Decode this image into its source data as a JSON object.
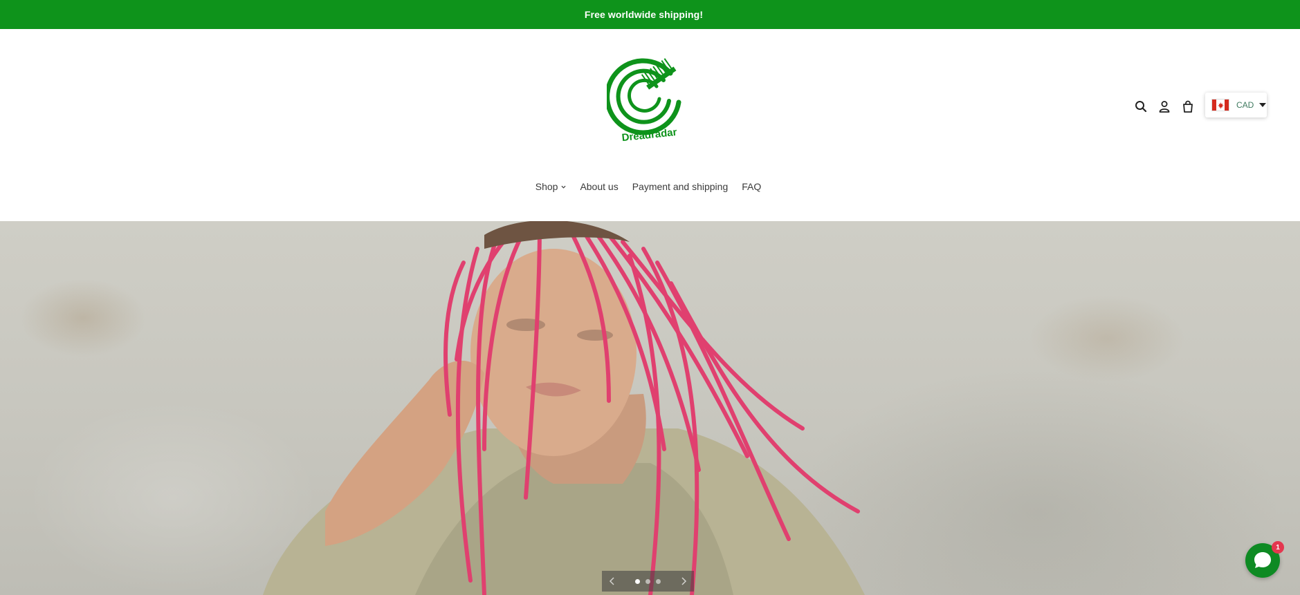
{
  "announcement": {
    "text": "Free worldwide shipping!"
  },
  "brand": {
    "name": "Dreadradar",
    "color": "#0e931b"
  },
  "header": {
    "icons": [
      "search-icon",
      "account-icon",
      "cart-icon"
    ],
    "currency": {
      "code": "CAD",
      "flag": "canada-flag-icon"
    }
  },
  "nav": {
    "items": [
      {
        "label": "Shop",
        "has_dropdown": true
      },
      {
        "label": "About us"
      },
      {
        "label": "Payment and shipping"
      },
      {
        "label": "FAQ"
      }
    ]
  },
  "hero": {
    "slide_count": 3,
    "active_slide": 1
  },
  "chat": {
    "unread_count": "1"
  }
}
